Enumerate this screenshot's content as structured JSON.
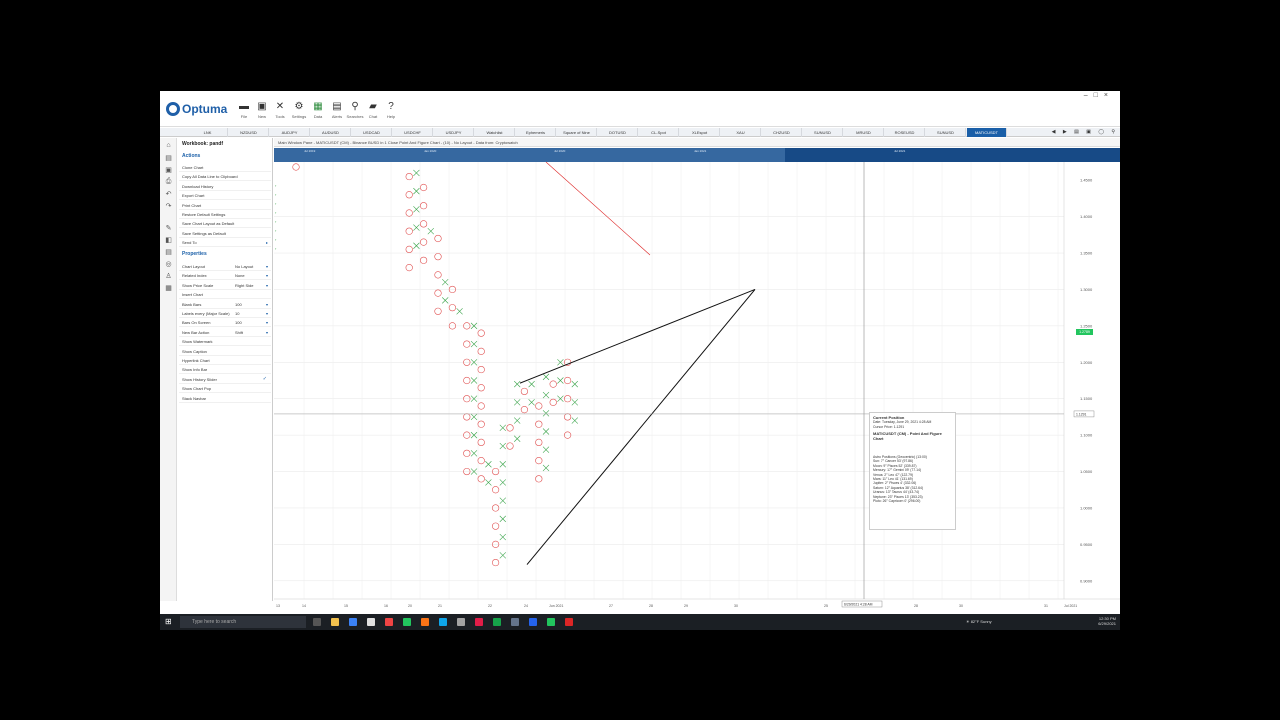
{
  "app": {
    "title": "Optuma",
    "window_controls": [
      "–",
      "□",
      "×"
    ]
  },
  "ribbon": {
    "buttons": [
      {
        "icon": "folder-icon",
        "label": "File"
      },
      {
        "icon": "new-icon",
        "label": "New"
      },
      {
        "icon": "tools-icon",
        "label": "Tools"
      },
      {
        "icon": "gear-icon",
        "label": "Settings"
      },
      {
        "icon": "grid-icon",
        "label": "Data"
      },
      {
        "icon": "alerts-icon",
        "label": "Alerts"
      },
      {
        "icon": "search-icon",
        "label": "Searches"
      },
      {
        "icon": "chat-icon",
        "label": "Chat"
      },
      {
        "icon": "help-icon",
        "label": "Help"
      }
    ]
  },
  "tabs": [
    "LNK",
    "NZDUSD",
    "AUDJPY",
    "AUDUSD",
    "USDCAD",
    "USDCHF",
    "USDJPY",
    "Watchlist",
    "Ephemeris",
    "Square of Nine",
    "DOTUSD",
    "CL-Spot",
    "XLEspot",
    "XAU",
    "CHZUSD",
    "SUNUSD",
    "MRUSD",
    "ROSEUSD",
    "SUNUSD",
    "MATICUSDT"
  ],
  "active_tab": "MATICUSDT",
  "workbook": {
    "title": "Workbook: pandf",
    "actions_header": "Actions",
    "actions": [
      "Clone Chart",
      "Copy All Data Line to Clipboard",
      "Download History",
      "Export Chart",
      "Print Chart",
      "Restore Default Settings",
      "Save Chart Layout as Default",
      "Save Settings as Default",
      "Send To"
    ],
    "properties_header": "Properties",
    "properties": [
      {
        "name": "Chart Layout",
        "value": "No Layout"
      },
      {
        "name": "Related Index",
        "value": "None"
      },
      {
        "name": "Show Price Scale",
        "value": "Right Side"
      },
      {
        "name": "Insert Chart",
        "value": ""
      },
      {
        "name": "Blank Bars",
        "value": "100"
      },
      {
        "name": "Labels every (Major Scale)",
        "value": "10"
      },
      {
        "name": "Bars On Screen",
        "value": "100"
      },
      {
        "name": "New Bar Action",
        "value": "Shift"
      },
      {
        "name": "Show Watermark",
        "value": ""
      },
      {
        "name": "Show Caption",
        "value": ""
      },
      {
        "name": "Hyperlink Chart",
        "value": ""
      },
      {
        "name": "Show Info Bar",
        "value": ""
      },
      {
        "name": "Show History Slider",
        "value": "✓"
      },
      {
        "name": "Show Chart Pop",
        "value": ""
      },
      {
        "name": "Stack Navbar",
        "value": ""
      }
    ]
  },
  "chart_header": "Main Window Pane - MATICUSDT (CM) - Binance BUSD in 1 Close Point And Figure Chart - (10) - No Layout - Data from: Cryptowatch",
  "overview_labels": [
    "Jul 2019",
    "Jan 2020",
    "Jul 2020",
    "Jan 2021",
    "Jul 2021"
  ],
  "price_tag": "1.2789",
  "y_ticks": [
    "1.4500",
    "1.4000",
    "1.3500",
    "1.3000",
    "1.2500",
    "1.2000",
    "1.1500",
    "1.1000",
    "1.0500",
    "1.0000",
    "0.9500",
    "0.9000"
  ],
  "x_ticks": [
    "13",
    "14",
    "15",
    "16",
    "20",
    "21",
    "22",
    "24",
    "Jun 2021",
    "27",
    "28",
    "29",
    "30",
    "25",
    "28",
    "30",
    "31",
    "Jul 2021"
  ],
  "crosshair_date": "6/29/2021 4:28 AM",
  "crosshair_price": "1.1291",
  "data_window": {
    "title": "Current Position",
    "date": "Date: Tuesday, June 29, 2021 4:28 AM",
    "price": "Cursor Price: 1.1291",
    "symbol": "MATICUSDT (CM) - Point And Figure Chart",
    "lines": [
      "Astro Positions (Geocentric) (13:00)",
      "Sun: 7° Cancer 53' (97.86)",
      "Moon: 9° Pisces 52' (339.87)",
      "Mercury: 17° Gemini 09' (77.14)",
      "Venus: 2° Leo 47' (122.79)",
      "Mars: 11° Leo 41' (131.69)",
      "Jupiter: 2° Pisces 4' (332.06)",
      "Saturn: 12° Aquarius 38' (312.64)",
      "Uranus: 13° Taurus 44' (43.74)",
      "Neptune: 23° Pisces 13' (353.23)",
      "Pluto: 26° Capricorn 0' (296.00)"
    ]
  },
  "chart_data": {
    "type": "point-and-figure",
    "symbol": "MATICUSDT",
    "box_size": 0.025,
    "columns": [
      {
        "type": "O",
        "high": 1.48,
        "low": 1.48
      },
      {
        "type": "O",
        "high": 1.48,
        "low": 1.31
      },
      {
        "type": "X",
        "high": 1.46,
        "low": 1.34
      },
      {
        "type": "O",
        "high": 1.44,
        "low": 1.33
      },
      {
        "type": "X",
        "high": 1.38,
        "low": 1.36
      },
      {
        "type": "O",
        "high": 1.37,
        "low": 1.25
      },
      {
        "type": "X",
        "high": 1.31,
        "low": 1.27
      },
      {
        "type": "O",
        "high": 1.3,
        "low": 1.25
      },
      {
        "type": "X",
        "high": 1.27,
        "low": 1.25
      },
      {
        "type": "O",
        "high": 1.25,
        "low": 1.03
      },
      {
        "type": "X",
        "high": 1.25,
        "low": 1.05
      },
      {
        "type": "O",
        "high": 1.24,
        "low": 1.03
      },
      {
        "type": "X",
        "high": 1.06,
        "low": 1.03
      },
      {
        "type": "O",
        "high": 1.05,
        "low": 0.92
      },
      {
        "type": "X",
        "high": 1.11,
        "low": 0.93
      },
      {
        "type": "O",
        "high": 1.11,
        "low": 1.08
      },
      {
        "type": "X",
        "high": 1.17,
        "low": 1.09
      },
      {
        "type": "O",
        "high": 1.16,
        "low": 1.13
      },
      {
        "type": "X",
        "high": 1.17,
        "low": 1.14
      },
      {
        "type": "O",
        "high": 1.14,
        "low": 1.03
      },
      {
        "type": "X",
        "high": 1.18,
        "low": 1.04
      },
      {
        "type": "O",
        "high": 1.17,
        "low": 1.14
      },
      {
        "type": "X",
        "high": 1.2,
        "low": 1.15
      },
      {
        "type": "O",
        "high": 1.2,
        "low": 1.09
      },
      {
        "type": "X",
        "high": 1.17,
        "low": 1.11
      }
    ],
    "trendlines": [
      {
        "from": [
          18.5,
          0.925
        ],
        "to": [
          25,
          1.3
        ]
      },
      {
        "from": [
          18.5,
          1.17
        ],
        "to": [
          25,
          1.3
        ]
      }
    ],
    "ylim": [
      0.875,
      1.475
    ],
    "grid": true
  }
}
